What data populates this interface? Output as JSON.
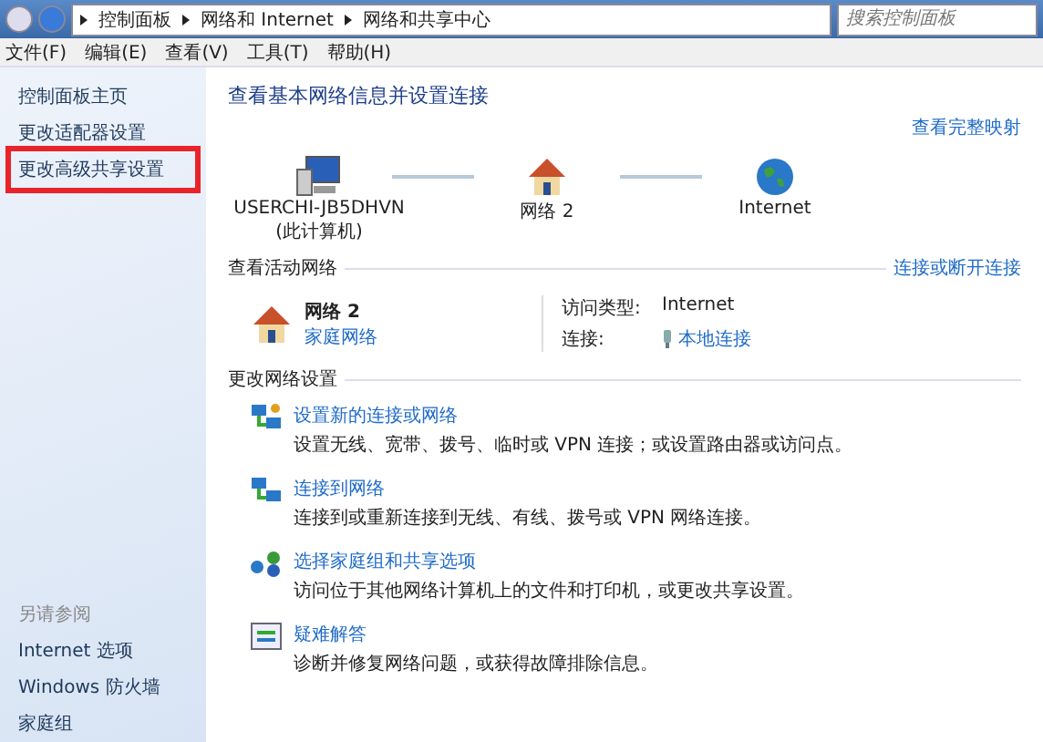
{
  "address_bar": {
    "breadcrumbs": [
      "控制面板",
      "网络和 Internet",
      "网络和共享中心"
    ],
    "search": {
      "placeholder": "搜索控制面板"
    }
  },
  "menu_bar": [
    "文件(F)",
    "编辑(E)",
    "查看(V)",
    "工具(T)",
    "帮助(H)"
  ],
  "sidebar": {
    "items": [
      {
        "label": "控制面板主页",
        "highlighted": false
      },
      {
        "label": "更改适配器设置",
        "highlighted": false
      },
      {
        "label": "更改高级共享设置",
        "highlighted": true
      }
    ],
    "see_also": {
      "title": "另请参阅",
      "links": [
        "Internet 选项",
        "Windows 防火墙",
        "家庭组"
      ]
    }
  },
  "main": {
    "title": "查看基本网络信息并设置连接",
    "full_map_link": "查看完整映射",
    "map": [
      {
        "kind": "computer",
        "label": "USERCHI-JB5DHVN",
        "sublabel": "(此计算机)"
      },
      {
        "kind": "house",
        "label": "网络  2"
      },
      {
        "kind": "globe",
        "label": "Internet"
      }
    ],
    "active_networks": {
      "title": "查看活动网络",
      "link": "连接或断开连接",
      "network_name": "网络  2",
      "network_type": "家庭网络",
      "access_type_label": "访问类型:",
      "access_type": "Internet",
      "connection_label": "连接:",
      "connection": "本地连接"
    },
    "change_settings": {
      "title": "更改网络设置",
      "tasks": [
        {
          "kind": "setup",
          "title": "设置新的连接或网络",
          "description": "设置无线、宽带、拨号、临时或 VPN 连接；或设置路由器或访问点。"
        },
        {
          "kind": "connect",
          "title": "连接到网络",
          "description": "连接到或重新连接到无线、有线、拨号或 VPN 网络连接。"
        },
        {
          "kind": "homegroup",
          "title": "选择家庭组和共享选项",
          "description": "访问位于其他网络计算机上的文件和打印机，或更改共享设置。"
        },
        {
          "kind": "troubleshoot",
          "title": "疑难解答",
          "description": "诊断并修复网络问题，或获得故障排除信息。"
        }
      ]
    }
  }
}
